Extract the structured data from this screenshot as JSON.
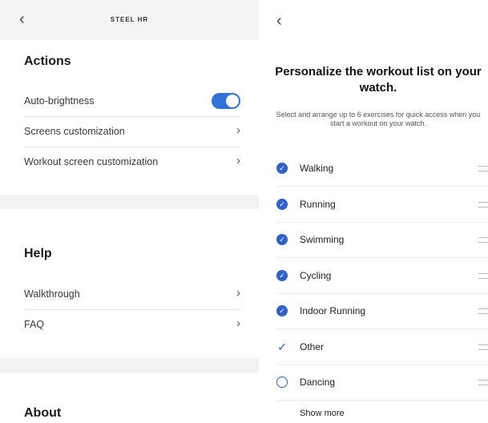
{
  "left": {
    "back_icon": "chevron-left-icon",
    "app_title": "STEEL HR",
    "actions": {
      "title": "Actions",
      "auto_brightness": {
        "label": "Auto-brightness",
        "enabled": true
      },
      "screens": {
        "label": "Screens customization"
      },
      "workout": {
        "label": "Workout screen customization"
      }
    },
    "help": {
      "title": "Help",
      "walkthrough": {
        "label": "Walkthrough"
      },
      "faq": {
        "label": "FAQ"
      }
    },
    "about": {
      "title": "About"
    }
  },
  "right": {
    "back_icon": "chevron-left-icon",
    "title": "Personalize the workout list on your watch.",
    "subtitle": "Select and arrange up to 6 exercises for quick access when you start a workout on your watch.",
    "exercises": [
      {
        "name": "Walking",
        "state": "checked"
      },
      {
        "name": "Running",
        "state": "checked"
      },
      {
        "name": "Swimming",
        "state": "checked"
      },
      {
        "name": "Cycling",
        "state": "checked"
      },
      {
        "name": "Indoor Running",
        "state": "checked"
      },
      {
        "name": "Other",
        "state": "check-only"
      },
      {
        "name": "Dancing",
        "state": "empty"
      }
    ],
    "show_more": "Show more"
  },
  "colors": {
    "accent": "#2f73d9",
    "checkbox": "#2f62c8",
    "divider": "#e6e6e6",
    "band": "#f2f2f2"
  }
}
